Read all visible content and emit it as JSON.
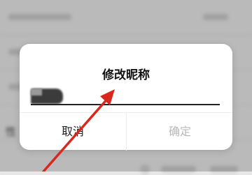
{
  "dialog": {
    "title": "修改昵称",
    "cancel_label": "取消",
    "confirm_label": "确定"
  },
  "background": {
    "partial_text": "性"
  },
  "colors": {
    "annotation_arrow": "#d8281e",
    "confirm_disabled": "#b8b8b8"
  }
}
